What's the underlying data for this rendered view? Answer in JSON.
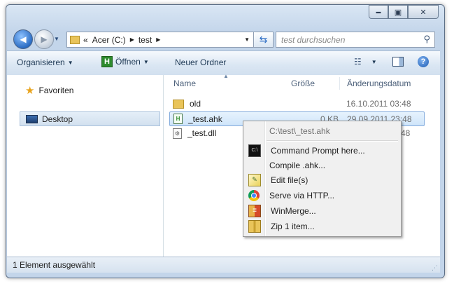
{
  "window": {
    "caption_buttons": [
      {
        "name": "minimize",
        "glyph": "▬"
      },
      {
        "name": "maximize",
        "glyph": "▣"
      },
      {
        "name": "close",
        "glyph": "✕"
      }
    ]
  },
  "address_bar": {
    "prefix": "«",
    "segments": [
      "Acer (C:)",
      "test"
    ]
  },
  "search": {
    "placeholder": "test durchsuchen"
  },
  "toolbar": {
    "organize": "Organisieren",
    "open": "Öffnen",
    "new_folder": "Neuer Ordner"
  },
  "navigation": {
    "favorites": "Favoriten",
    "desktop": "Desktop"
  },
  "columns": {
    "name": "Name",
    "size": "Größe",
    "date": "Änderungsdatum"
  },
  "files": [
    {
      "name": "old",
      "size": "",
      "date": "16.10.2011 03:48",
      "icon": "folder-icon"
    },
    {
      "name": "_test.ahk",
      "size": "0 KB",
      "date": "29.09.2011 23:48",
      "icon": "ahk-file-icon"
    },
    {
      "name": "_test.dll",
      "size": "",
      "date": "48",
      "icon": "dll-file-icon"
    }
  ],
  "context_menu": {
    "header": "C:\\test\\_test.ahk",
    "items": [
      {
        "label": "Command Prompt here...",
        "icon": "command-prompt-icon"
      },
      {
        "label": "Compile .ahk...",
        "icon": "compile-icon"
      },
      {
        "label": "Edit file(s)",
        "icon": "edit-icon"
      },
      {
        "label": "Serve via HTTP...",
        "icon": "chrome-icon"
      },
      {
        "label": "WinMerge...",
        "icon": "winmerge-icon"
      },
      {
        "label": "Zip 1 item...",
        "icon": "zip-icon"
      }
    ]
  },
  "status": {
    "text": "1 Element ausgewählt"
  },
  "colors": {
    "accent": "#2c6dc4",
    "selection": "#cfe5fa",
    "folder": "#e9c45a"
  }
}
